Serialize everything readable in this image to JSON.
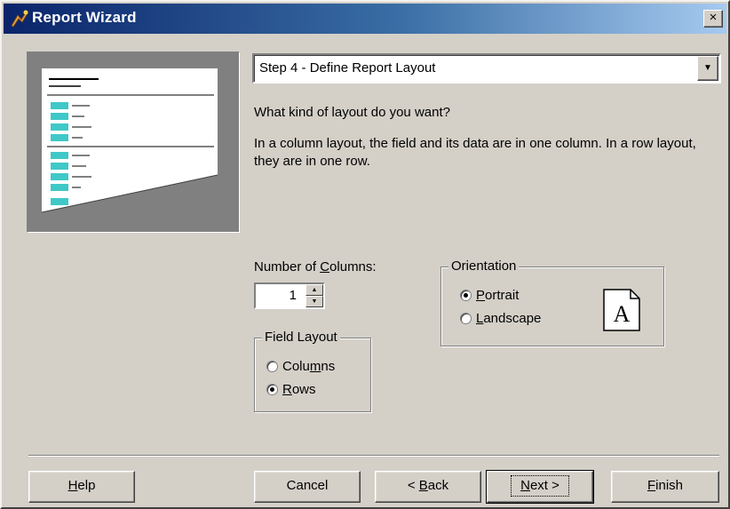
{
  "window": {
    "title": "Report Wizard",
    "close_label": "×"
  },
  "step_select": {
    "value": "Step 4 - Define Report Layout"
  },
  "question": "What kind of layout do you want?",
  "description": "In a column layout, the field and its data are in one column. In a row layout, they are in one row.",
  "columns": {
    "label_pre": "Number of ",
    "label_u": "C",
    "label_post": "olumns:",
    "value": "1"
  },
  "field_layout": {
    "legend": "Field Layout",
    "options": [
      {
        "pre": "Colu",
        "u": "m",
        "post": "ns",
        "checked": false
      },
      {
        "pre": "",
        "u": "R",
        "post": "ows",
        "checked": true
      }
    ]
  },
  "orientation": {
    "legend": "Orientation",
    "options": [
      {
        "pre": "",
        "u": "P",
        "post": "ortrait",
        "checked": true
      },
      {
        "pre": "",
        "u": "L",
        "post": "andscape",
        "checked": false
      }
    ],
    "icon_letter": "A"
  },
  "buttons": {
    "help": {
      "pre": "",
      "u": "H",
      "post": "elp"
    },
    "cancel": "Cancel",
    "back": {
      "pre": "< ",
      "u": "B",
      "post": "ack"
    },
    "next": {
      "pre": "",
      "u": "N",
      "post": "ext >"
    },
    "finish": {
      "pre": "",
      "u": "F",
      "post": "inish"
    }
  }
}
